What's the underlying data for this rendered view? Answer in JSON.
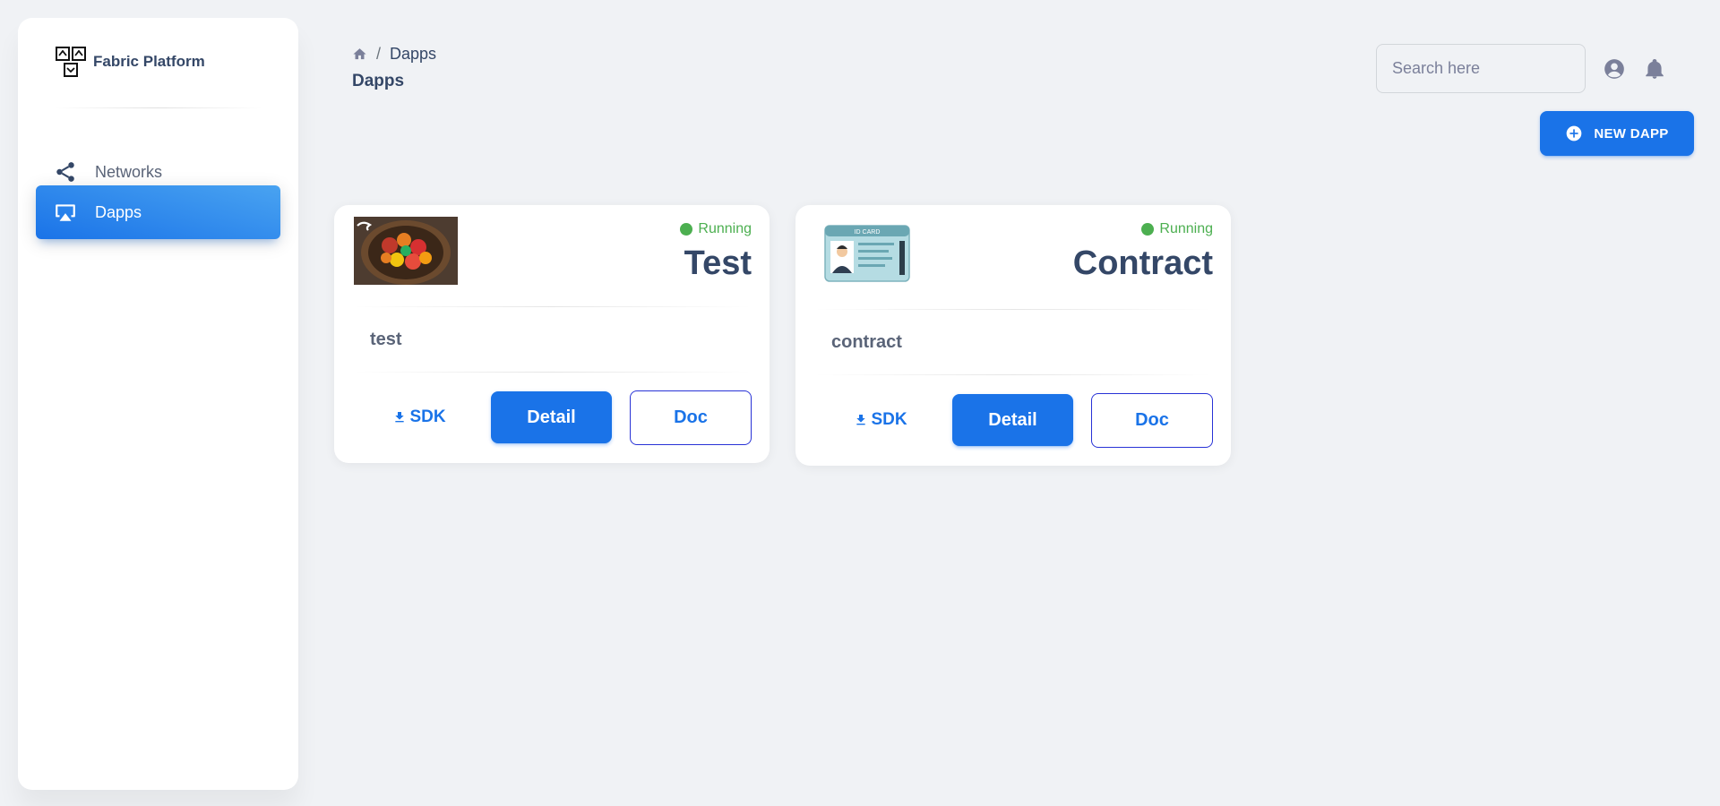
{
  "brand": {
    "name": "Fabric Platform",
    "logo_icon": "fabric-logo-icon"
  },
  "sidebar": {
    "items": [
      {
        "label": "Networks",
        "icon": "share-icon",
        "active": false
      },
      {
        "label": "Dapps",
        "icon": "airplay-icon",
        "active": true
      }
    ]
  },
  "header": {
    "breadcrumb": {
      "home_icon": "home-icon",
      "separator": "/",
      "current": "Dapps"
    },
    "title": "Dapps",
    "search": {
      "placeholder": "Search here",
      "value": ""
    },
    "icons": [
      "account-circle-icon",
      "bell-icon"
    ]
  },
  "actions": {
    "new_dapp_label": "NEW DAPP",
    "new_dapp_icon": "add-circle-icon"
  },
  "cards": [
    {
      "name": "Test",
      "status": "Running",
      "description": "test",
      "thumbnail": "fruit-bowl-image",
      "sdk_label": "SDK",
      "detail_label": "Detail",
      "doc_label": "Doc"
    },
    {
      "name": "Contract",
      "status": "Running",
      "description": "contract",
      "thumbnail": "id-card-image",
      "thumbnail_text": "ID CARD",
      "sdk_label": "SDK",
      "detail_label": "Detail",
      "doc_label": "Doc"
    }
  ],
  "colors": {
    "primary": "#1A73E8",
    "status_running": "#4CAF50",
    "text_dark": "#344767",
    "background": "#f0f2f5"
  }
}
